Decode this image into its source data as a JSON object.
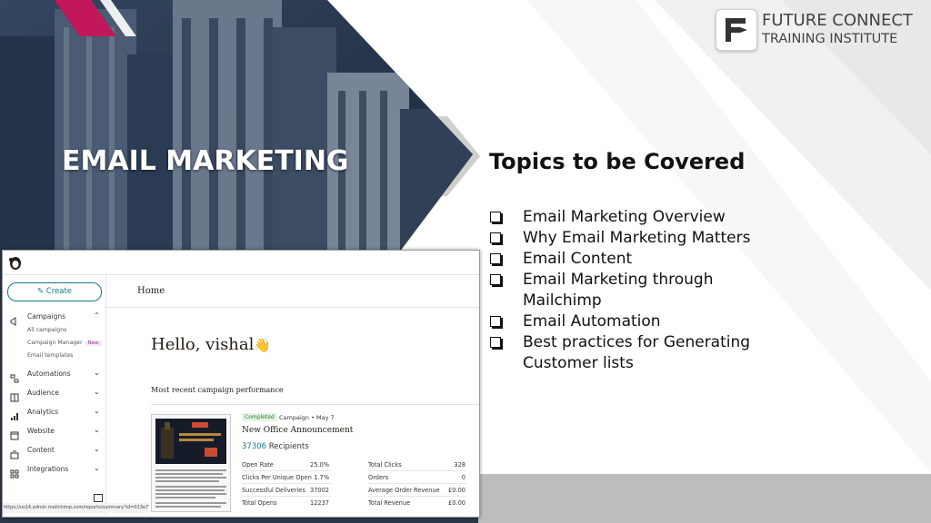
{
  "slide": {
    "title": "EMAIL MARKETING",
    "logo": {
      "line1": "FUTURE CONNECT",
      "line2": "TRAINING INSTITUTE",
      "icon": "fc-logo-icon"
    },
    "topics_title": "Topics to be Covered",
    "topics": [
      "Email Marketing Overview",
      "Why Email Marketing Matters",
      "Email Content",
      "Email Marketing through Mailchimp",
      "Email Automation",
      "Best practices for Generating Customer lists"
    ],
    "colors": {
      "accent_magenta": "#c2185b",
      "teal": "#0f7c86",
      "dark_blue": "#1d2b3d"
    }
  },
  "mailchimp": {
    "create_label": "Create",
    "nav": {
      "campaigns": "Campaigns",
      "sub": {
        "all": "All campaigns",
        "manager": "Campaign Manager",
        "new_badge": "New",
        "templates": "Email templates"
      },
      "automations": "Automations",
      "audience": "Audience",
      "analytics": "Analytics",
      "website": "Website",
      "content": "Content",
      "integrations": "Integrations"
    },
    "status_url": "https://us14.admin.mailchimp.com/reports/summary?id=013e775b1a",
    "home_label": "Home",
    "greeting": "Hello, vishal",
    "greeting_emoji": "👋",
    "recent_title": "Most recent campaign performance",
    "campaign": {
      "status": "Completed",
      "meta": "Campaign • May 7",
      "name": "New Office Announcement",
      "recipients_count": "37306",
      "recipients_label": "Recipients",
      "stats_left": [
        {
          "label": "Open Rate",
          "value": "25.0%"
        },
        {
          "label": "Clicks Per Unique Open",
          "value": "1.7%"
        },
        {
          "label": "Successful Deliveries",
          "value": "37002"
        },
        {
          "label": "Total Opens",
          "value": "12237"
        }
      ],
      "stats_right": [
        {
          "label": "Total Clicks",
          "value": "328"
        },
        {
          "label": "Orders",
          "value": "0"
        },
        {
          "label": "Average Order Revenue",
          "value": "£0.00"
        },
        {
          "label": "Total Revenue",
          "value": "£0.00"
        }
      ]
    }
  }
}
